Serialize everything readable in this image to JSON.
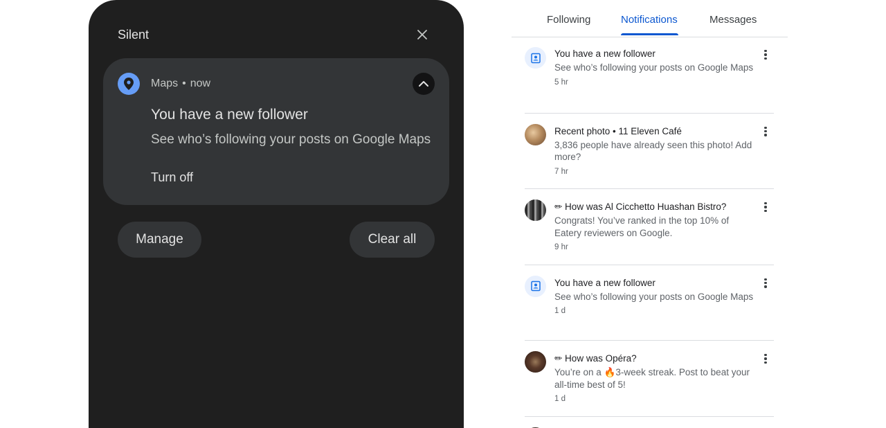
{
  "shade": {
    "title": "Silent",
    "notification": {
      "app_name": "Maps",
      "separator": "•",
      "time": "now",
      "title": "You have a new follower",
      "body": "See who’s following your posts on Google Maps",
      "action": "Turn off"
    },
    "manage_label": "Manage",
    "clear_all_label": "Clear all"
  },
  "tabs": [
    {
      "label": "Following",
      "active": false
    },
    {
      "label": "Notifications",
      "active": true
    },
    {
      "label": "Messages",
      "active": false
    }
  ],
  "feed": [
    {
      "avatar": "follower-icon",
      "title": "You have a new follower",
      "body": "See who’s following your posts on Google Maps",
      "time": "5 hr"
    },
    {
      "avatar": "photo",
      "title": "Recent photo • 11 Eleven Café",
      "body": "3,836 people have already seen this photo! Add more?",
      "time": "7 hr"
    },
    {
      "avatar": "photo",
      "title": "✏ How was Al Cicchetto Huashan Bistro?",
      "body": "Congrats! You’ve ranked in the top 10% of Eatery reviewers on Google.",
      "time": "9 hr"
    },
    {
      "avatar": "follower-icon",
      "title": "You have a new follower",
      "body": "See who’s following your posts on Google Maps",
      "time": "1 d"
    },
    {
      "avatar": "photo",
      "title": "✏ How was Opéra?",
      "body": "You’re on a 🔥3-week streak. Post to beat your all-time best of 5!",
      "time": "1 d"
    }
  ],
  "colors": {
    "shade_bg": "#1f1f1f",
    "card_bg": "#333537",
    "maps_icon": "#669df6",
    "tab_active": "#0b57d0"
  }
}
